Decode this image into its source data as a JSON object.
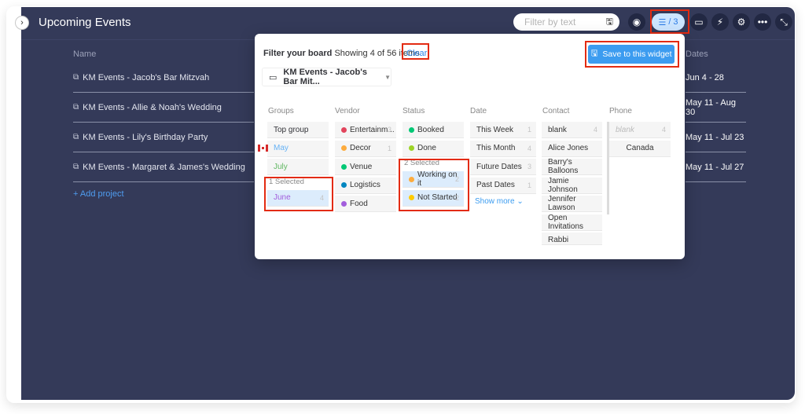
{
  "board": {
    "title": "Upcoming Events",
    "collapse_icon": "chevron-right-icon",
    "search": {
      "placeholder": "Filter by text",
      "value": ""
    },
    "filter_button": {
      "label": "/ 3"
    },
    "columns": {
      "name": "Name",
      "dates": "Dates"
    },
    "projects": [
      {
        "name": "KM Events - Jacob's Bar Mitzvah",
        "dates": "Jun 4 - 28"
      },
      {
        "name": "KM Events - Allie & Noah's Wedding",
        "dates": "May 11 - Aug 30"
      },
      {
        "name": "KM Events - Lily's Birthday Party",
        "dates": "May 11 - Jul 23"
      },
      {
        "name": "KM Events - Margaret & James's Wedding",
        "dates": "May 11 - Jul 27"
      }
    ],
    "add_project": "+ Add project"
  },
  "filter_panel": {
    "title": "Filter your board",
    "summary": "Showing 4 of 56 items",
    "clear": "Clear",
    "board_select": "KM Events - Jacob's Bar Mit...",
    "save_button": "Save to this widget",
    "groups": {
      "header": "Groups",
      "items": [
        {
          "label": "Top group",
          "color": "#323338"
        },
        {
          "label": "May",
          "color": "#66b2f5"
        },
        {
          "label": "July",
          "color": "#5fb760"
        }
      ],
      "selected_label": "1 Selected",
      "selected": [
        {
          "label": "June",
          "count": "4",
          "color": "#a25ddc"
        }
      ]
    },
    "vendor": {
      "header": "Vendor",
      "items": [
        {
          "label": "Entertainm...",
          "count": "3",
          "dot": "#e2445c"
        },
        {
          "label": "Decor",
          "count": "1",
          "dot": "#fdab3d"
        },
        {
          "label": "Venue",
          "count": "",
          "dot": "#00c875"
        },
        {
          "label": "Logistics",
          "count": "",
          "dot": "#0086c0"
        },
        {
          "label": "Food",
          "count": "",
          "dot": "#a25ddc"
        }
      ]
    },
    "status": {
      "header": "Status",
      "items": [
        {
          "label": "Booked",
          "dot": "#00c875"
        },
        {
          "label": "Done",
          "dot": "#9cd326"
        }
      ],
      "selected_label": "2 Selected",
      "selected": [
        {
          "label": "Working on it",
          "count": "2",
          "dot": "#fdab3d"
        },
        {
          "label": "Not Started",
          "count": "2",
          "dot": "#ffcb00"
        }
      ]
    },
    "date": {
      "header": "Date",
      "items": [
        {
          "label": "This Week",
          "count": "1"
        },
        {
          "label": "This Month",
          "count": "4"
        },
        {
          "label": "Future Dates",
          "count": "3"
        },
        {
          "label": "Past Dates",
          "count": "1"
        }
      ],
      "show_more": "Show more"
    },
    "contact": {
      "header": "Contact",
      "items": [
        {
          "label": "blank",
          "count": "4"
        },
        {
          "label": "Alice Jones",
          "count": ""
        },
        {
          "label": "Barry's Balloons",
          "count": ""
        },
        {
          "label": "Jamie Johnson",
          "count": ""
        },
        {
          "label": "Jennifer Lawson",
          "count": ""
        },
        {
          "label": "Open Invitations",
          "count": ""
        },
        {
          "label": "Rabbi Udelman",
          "count": ""
        }
      ]
    },
    "phone": {
      "header": "Phone",
      "items": [
        {
          "label": "blank",
          "count": "4"
        },
        {
          "label": "Canada",
          "count": ""
        }
      ]
    }
  }
}
